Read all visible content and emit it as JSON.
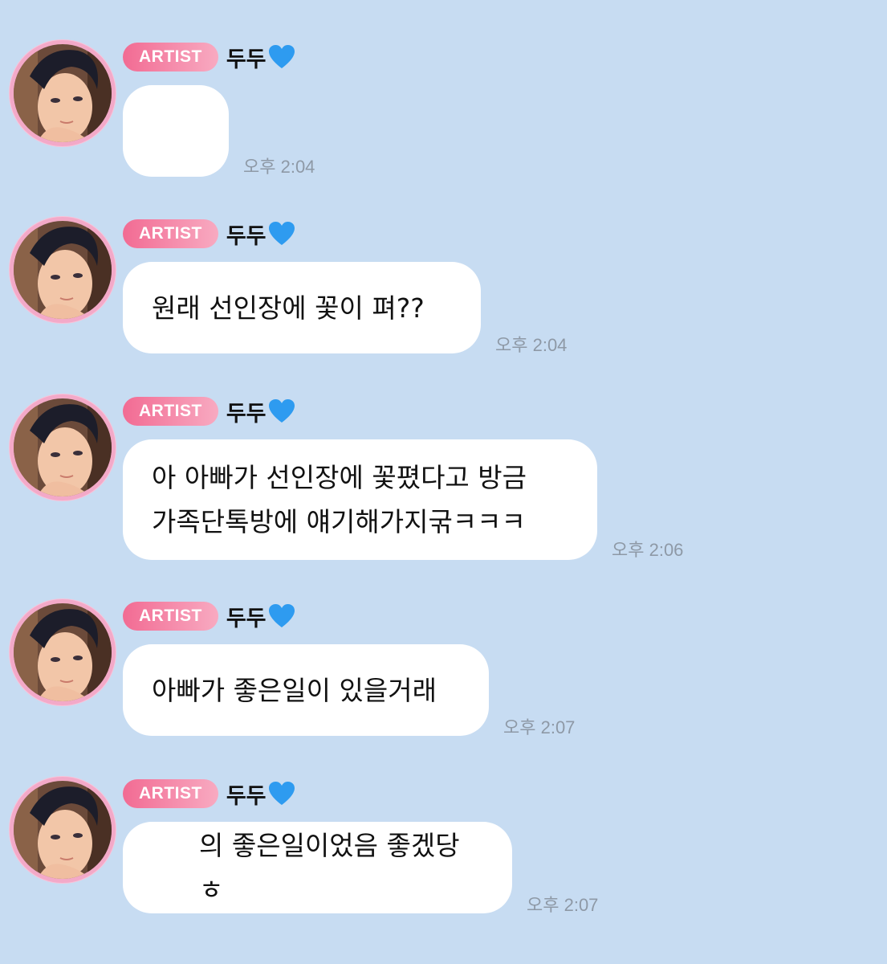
{
  "chat": {
    "colors": {
      "background": "#c7dcf2",
      "badge_start": "#f26b93",
      "badge_end": "#f8aac1",
      "bubble": "#ffffff",
      "heart": "#2e9bf0"
    },
    "messages": [
      {
        "badge": "ARTIST",
        "sender": "두두",
        "sender_icon": "blue-heart-icon",
        "text": "",
        "time": "오후 2:04"
      },
      {
        "badge": "ARTIST",
        "sender": "두두",
        "sender_icon": "blue-heart-icon",
        "text": "원래 선인장에 꽃이 펴??",
        "time": "오후 2:04"
      },
      {
        "badge": "ARTIST",
        "sender": "두두",
        "sender_icon": "blue-heart-icon",
        "text": "아 아빠가 선인장에 꽃폈다고 방금\n가족단톡방에 얘기해가지굮ㅋㅋㅋ",
        "time": "오후 2:06"
      },
      {
        "badge": "ARTIST",
        "sender": "두두",
        "sender_icon": "blue-heart-icon",
        "text": "아빠가 좋은일이 있을거래",
        "time": "오후 2:07"
      },
      {
        "badge": "ARTIST",
        "sender": "두두",
        "sender_icon": "blue-heart-icon",
        "text": "의 좋은일이었음 좋겠당ㅎ",
        "time": "오후 2:07"
      }
    ]
  }
}
